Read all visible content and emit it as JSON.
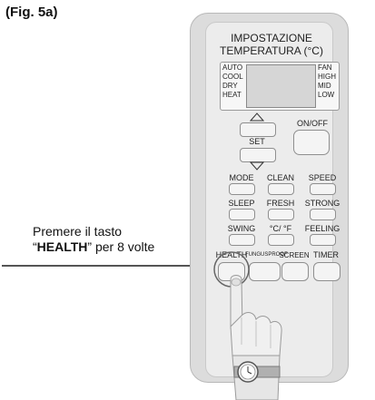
{
  "figure_label": "(Fig. 5a)",
  "instruction": {
    "line1": "Premere il tasto",
    "line2_pre": "“",
    "line2_key": "HEALTH",
    "line2_post": "” per 8 volte"
  },
  "remote": {
    "title_line1": "IMPOSTAZIONE",
    "title_line2": "TEMPERATURA (°C)",
    "lcd_left": [
      "AUTO",
      "COOL",
      "DRY",
      "HEAT"
    ],
    "lcd_right": [
      "FAN",
      "HIGH",
      "MID",
      "LOW"
    ],
    "set_label": "SET",
    "onoff_label": "ON/OFF",
    "row1": [
      "MODE",
      "CLEAN",
      "SPEED"
    ],
    "row2": [
      "SLEEP",
      "FRESH",
      "STRONG"
    ],
    "row3": [
      "SWING",
      "°C/ °F",
      "FEELING"
    ],
    "row4": [
      "HEALTH",
      "FUNGUSPROOF",
      "SCREEN",
      "TIMER"
    ]
  },
  "colors": {
    "remote_body": "#dcdcdc",
    "button": "#f4f4f4",
    "pointer_line": "#555555"
  }
}
